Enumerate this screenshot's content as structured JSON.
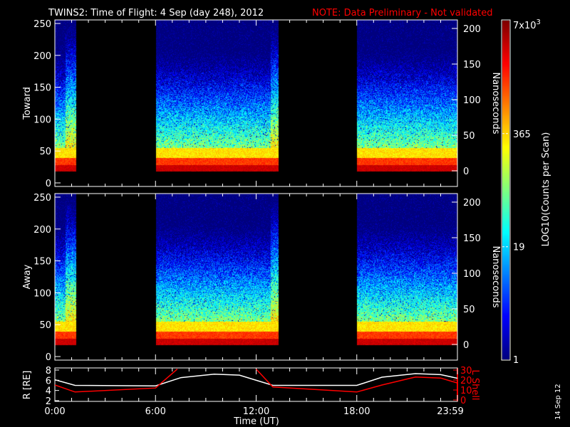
{
  "title": "TWINS2: Time of Flight:  4 Sep (day 248), 2012",
  "note": "NOTE: Data Preliminary - Not validated",
  "note_color": "#ff0000",
  "footer_date": "14 Sep 12",
  "chart_data": [
    {
      "type": "heatmap",
      "name": "Toward",
      "ylabel": "Toward",
      "y2label": "Nanoseconds",
      "yticks": [
        "0",
        "50",
        "100",
        "150",
        "200",
        "250"
      ],
      "y2ticks": [
        "0",
        "50",
        "100",
        "150",
        "200"
      ],
      "ylim": [
        0,
        256
      ],
      "data_intervals_hours": [
        [
          0.0,
          1.25
        ],
        [
          6.0,
          13.3
        ],
        [
          18.0,
          24.0
        ]
      ],
      "bright_strips_hours": [
        [
          0.6,
          1.25
        ],
        [
          12.85,
          13.3
        ]
      ]
    },
    {
      "type": "heatmap",
      "name": "Away",
      "ylabel": "Away",
      "y2label": "Nanoseconds",
      "yticks": [
        "0",
        "50",
        "100",
        "150",
        "200",
        "250"
      ],
      "y2ticks": [
        "0",
        "50",
        "100",
        "150",
        "200"
      ],
      "ylim": [
        0,
        256
      ],
      "data_intervals_hours": [
        [
          0.0,
          1.25
        ],
        [
          6.0,
          13.3
        ],
        [
          18.0,
          24.0
        ]
      ],
      "bright_strips_hours": [
        [
          0.6,
          1.25
        ],
        [
          12.85,
          13.3
        ]
      ]
    },
    {
      "type": "line",
      "name": "orbit",
      "ylabel": "R [RE]",
      "y2label": "L Shell",
      "yticks": [
        "2",
        "4",
        "6",
        "8"
      ],
      "y2ticks": [
        "0",
        "10",
        "20",
        "30"
      ],
      "ylim": [
        2,
        8
      ],
      "y2lim": [
        0,
        30
      ],
      "xlabel": "Time (UT)",
      "xticks": [
        "0:00",
        "6:00",
        "12:00",
        "18:00",
        "23:59"
      ],
      "series": [
        {
          "name": "R",
          "color": "#ffffff",
          "x": [
            0,
            1.2,
            6,
            7.5,
            9.5,
            11,
            13,
            18,
            19.5,
            21.5,
            23,
            24
          ],
          "y": [
            6.1,
            5.0,
            4.9,
            6.5,
            7.2,
            7.0,
            5.0,
            5.0,
            6.6,
            7.3,
            7.1,
            6.4
          ]
        },
        {
          "name": "L Shell",
          "color": "#ff0000",
          "x": [
            0,
            1.2,
            6,
            7.3
          ],
          "y": [
            15,
            8,
            12,
            31
          ]
        },
        {
          "name": "L Shell",
          "color": "#ff0000",
          "x": [
            12,
            13,
            18,
            19.5,
            21.5,
            23,
            24
          ],
          "y": [
            31,
            13,
            8,
            15,
            23,
            22,
            17
          ]
        }
      ]
    },
    {
      "type": "colorbar",
      "label": "LOG10(Counts per Scan)",
      "ticks": [
        "1",
        "19",
        "365",
        "7x10^3"
      ],
      "tick_label_base": "7x10",
      "tick_label_exp": "3",
      "range": [
        1,
        7000
      ]
    }
  ]
}
